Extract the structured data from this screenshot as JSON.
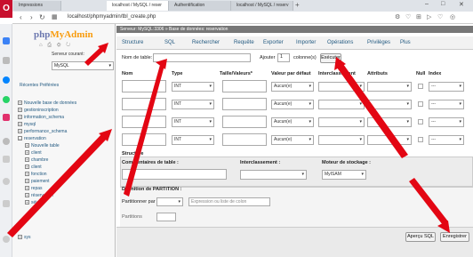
{
  "browser": {
    "tabs": [
      "Impressions",
      "localhost / MySQL / reser",
      "Authentification",
      "localhost / MySQL / reserv"
    ],
    "url": "localhost/phpmyadmin/tbl_create.php",
    "window_controls": [
      "–",
      "□",
      "✕"
    ]
  },
  "nav": {
    "logo_php": "php",
    "logo_my": "MyAdmin",
    "server_label": "Serveur courant:",
    "server_value": "MySQL",
    "recent_fav": "Récentes   Préférées",
    "tree": [
      "Nouvelle base de données",
      "gestioninscription",
      "information_schema",
      "mysql",
      "performance_schema",
      "reservation",
      "Nouvelle table",
      "client",
      "chambre",
      "client",
      "fonction",
      "paiement",
      "repas",
      "réservation",
      "séjour",
      "sys"
    ]
  },
  "main": {
    "breadcrumb": "Serveur: MySQL:3306 » Base de données: reservation",
    "menu": [
      "Structure",
      "SQL",
      "Rechercher",
      "Requête",
      "Exporter",
      "Importer",
      "Opérations",
      "Privilèges",
      "Plus"
    ],
    "table_name_label": "Nom de table:",
    "add_label": "Ajouter",
    "add_value": "1",
    "columns_label": "colonne(s)",
    "execute_label": "Exécuter",
    "col_headers": [
      "Nom",
      "Type",
      "Taille/Valeurs*",
      "Valeur par défaut",
      "Interclassement",
      "Attributs",
      "Null",
      "Index"
    ],
    "rows": [
      {
        "type": "INT",
        "default": "Aucun(e)",
        "index": "---"
      },
      {
        "type": "INT",
        "default": "Aucun(e)",
        "index": "---"
      },
      {
        "type": "INT",
        "default": "Aucun(e)",
        "index": "---"
      },
      {
        "type": "INT",
        "default": "Aucun(e)",
        "index": "---"
      }
    ],
    "structure_label": "Structure",
    "table_comments_label": "Commentaires de table :",
    "collation_label": "Interclassement :",
    "engine_label": "Moteur de stockage :",
    "engine_value": "MyISAM",
    "partition_label": "Définition de PARTITION :",
    "partition_by_label": "Partitionner par",
    "expression_placeholder": "Expression ou liste de colon",
    "partitions_label": "Partitions",
    "preview_sql": "Aperçu SQL",
    "save_label": "Enregistrer"
  }
}
